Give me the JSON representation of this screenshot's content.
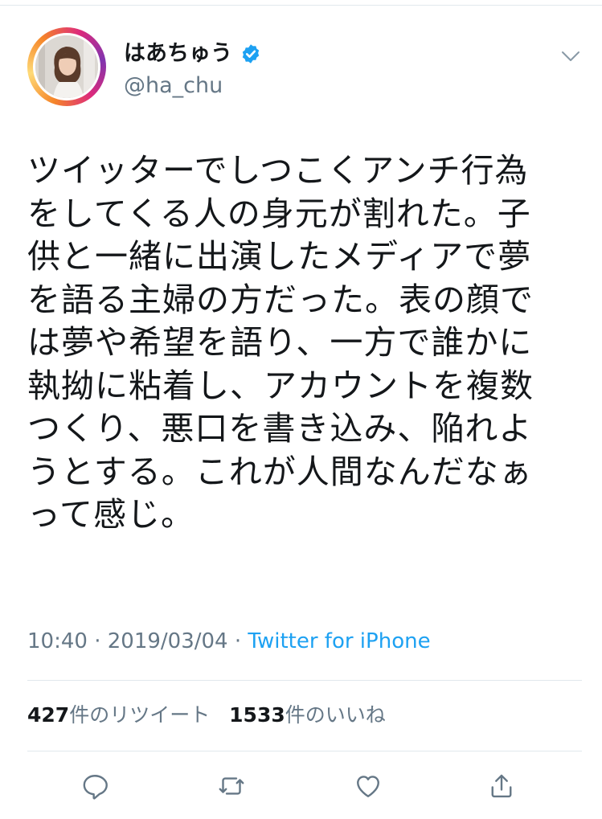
{
  "user": {
    "display_name": "はあちゅう",
    "handle": "@ha_chu",
    "verified": true
  },
  "tweet": {
    "text": "ツイッターでしつこくアンチ行為\nをしてくる人の身元が割れた。子\n供と一緒に出演したメディアで夢\nを語る主婦の方だった。表の顔で\nは夢や希望を語り、一方で誰かに\n執拗に粘着し、アカウントを複数\nつくり、悪口を書き込み、陥れよ\nうとする。これが人間なんだなぁ\nって感じ。",
    "time": "10:40",
    "separator": "·",
    "date": "2019/03/04",
    "source": "Twitter for iPhone"
  },
  "stats": {
    "retweets_count": "427",
    "retweets_label": "件のリツイート",
    "likes_count": "1533",
    "likes_label": "件のいいね"
  },
  "actions": {
    "items": [
      "reply-icon",
      "retweet-icon",
      "like-icon",
      "share-icon"
    ]
  },
  "colors": {
    "accent": "#1da1f2",
    "text": "#14171a",
    "muted": "#657786",
    "border": "#e1e8ed"
  }
}
